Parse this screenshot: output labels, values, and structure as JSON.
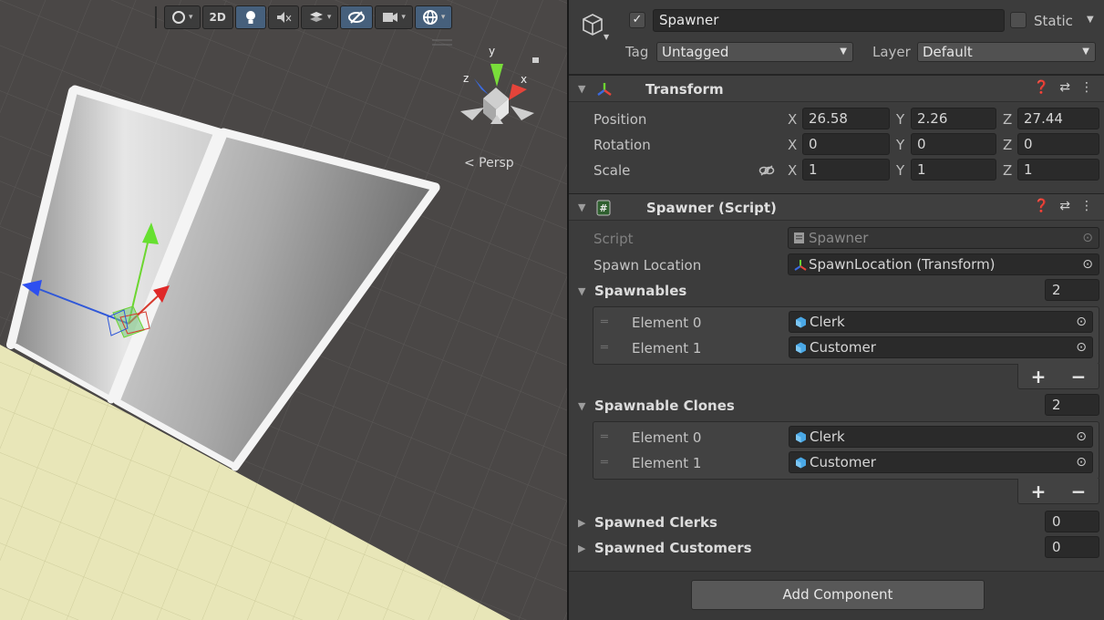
{
  "scene": {
    "toolbar": {
      "shading_caret": "▾",
      "mode_2d": "2D",
      "caret": "▾"
    },
    "persp_label": "< Persp",
    "gizmo_axes": {
      "x": "x",
      "y": "y",
      "z": "z"
    },
    "colors": {
      "floor": "#e8e6b8",
      "wall": "#b8b8b8",
      "x_axis": "#d63a2e",
      "y_axis": "#6cd630",
      "z_axis": "#3058d8"
    }
  },
  "inspector": {
    "object_name": "Spawner",
    "active": true,
    "static_label": "Static",
    "tag_label": "Tag",
    "tag_value": "Untagged",
    "layer_label": "Layer",
    "layer_value": "Default",
    "transform": {
      "title": "Transform",
      "position": {
        "label": "Position",
        "x": "26.58",
        "y": "2.26",
        "z": "27.44"
      },
      "rotation": {
        "label": "Rotation",
        "x": "0",
        "y": "0",
        "z": "0"
      },
      "scale": {
        "label": "Scale",
        "x": "1",
        "y": "1",
        "z": "1"
      },
      "axis_labels": {
        "x": "X",
        "y": "Y",
        "z": "Z"
      }
    },
    "script_component": {
      "title": "Spawner (Script)",
      "script_label": "Script",
      "script_value": "Spawner",
      "spawn_location_label": "Spawn Location",
      "spawn_location_value": "SpawnLocation (Transform)",
      "spawnables": {
        "label": "Spawnables",
        "size": "2",
        "elements": [
          {
            "label": "Element 0",
            "value": "Clerk"
          },
          {
            "label": "Element 1",
            "value": "Customer"
          }
        ]
      },
      "spawnable_clones": {
        "label": "Spawnable Clones",
        "size": "2",
        "elements": [
          {
            "label": "Element 0",
            "value": "Clerk"
          },
          {
            "label": "Element 1",
            "value": "Customer"
          }
        ]
      },
      "spawned_clerks": {
        "label": "Spawned Clerks",
        "size": "0"
      },
      "spawned_customers": {
        "label": "Spawned Customers",
        "size": "0"
      },
      "add_symbol": "+",
      "remove_symbol": "−"
    },
    "add_component_label": "Add Component"
  }
}
